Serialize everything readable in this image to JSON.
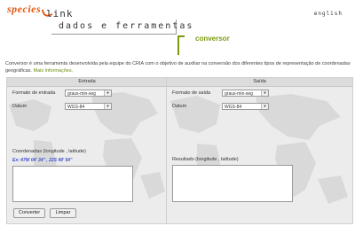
{
  "header": {
    "logo_species": "species",
    "logo_link": "link",
    "tagline": "dados e ferramentas",
    "language_link": "english",
    "page_title": "conversor"
  },
  "intro": {
    "text": "Conversor é uma ferramenta desenvolvida pela equipe do CRIA com o objetivo de auxiliar na conversão dos diferentes tipos de representação de coordenadas geográficas.",
    "more_link": "Mais informações."
  },
  "input_panel": {
    "heading": "Entrada",
    "format_label": "Formato de entrada",
    "format_value": "graus-min-seg",
    "datum_label": "Datum",
    "datum_value": "WGS-84",
    "coords_label": "Coordenadas (longitude , latitude)",
    "example": "Ex: 47W 04' 34\" , 22S 49' 54\"",
    "convert_button": "Converter",
    "clear_button": "Limpar"
  },
  "output_panel": {
    "heading": "Saída",
    "format_label": "Formato de saída",
    "format_value": "graus-min-seg",
    "datum_label": "Datum",
    "datum_value": "WGS-84",
    "result_label": "Resultado (longitude , latitude)"
  },
  "colors": {
    "brand_orange": "#e05a14",
    "brand_green": "#7a9a0c",
    "hint_blue": "#3b4fcf"
  }
}
